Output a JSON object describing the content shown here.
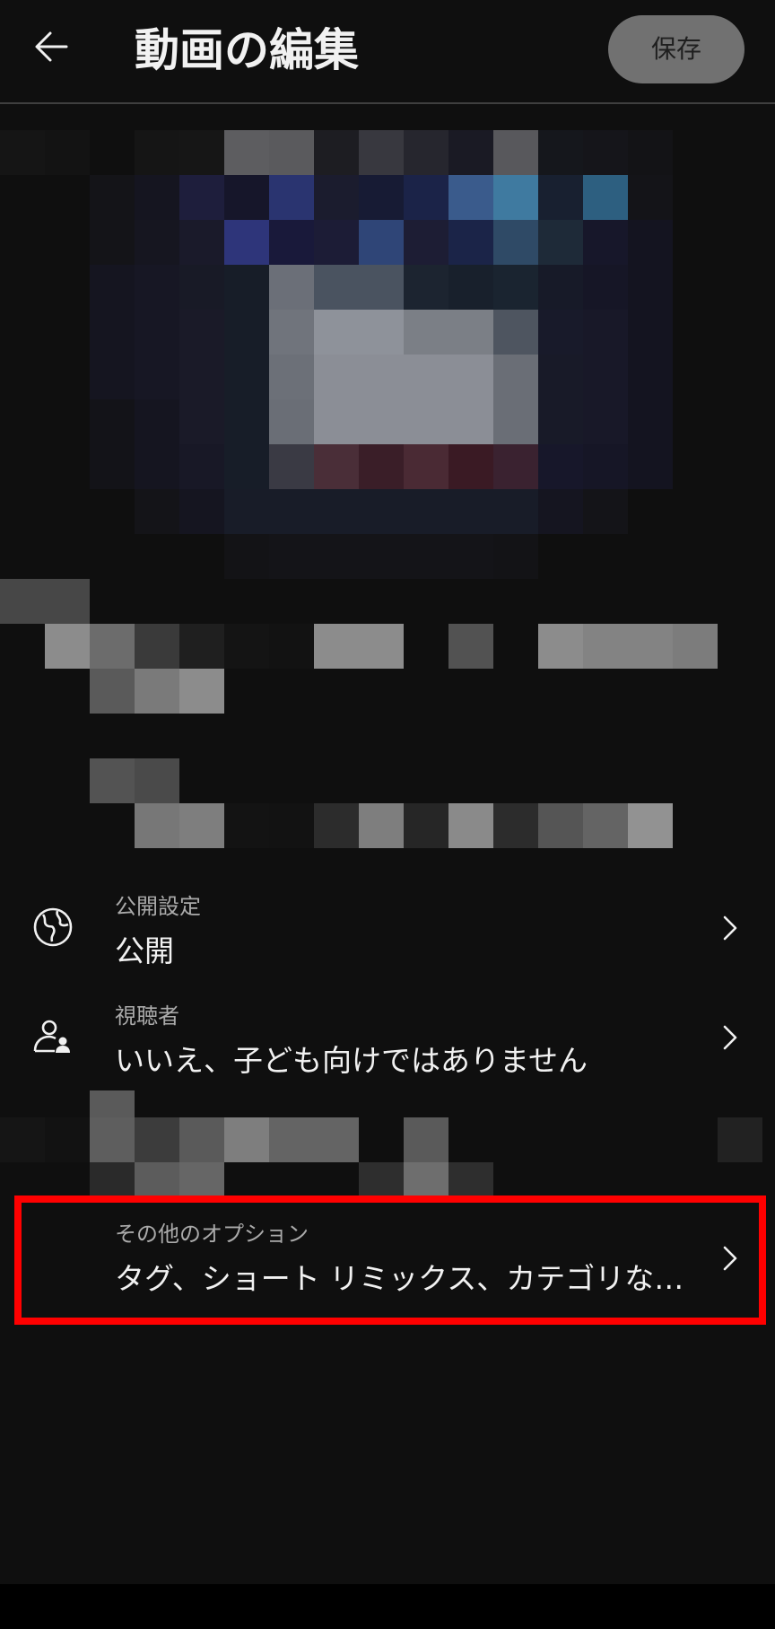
{
  "header": {
    "back_icon": "arrow-left-icon",
    "title": "動画の編集",
    "save_label": "保存"
  },
  "settings": {
    "visibility": {
      "icon": "globe-icon",
      "label": "公開設定",
      "value": "公開"
    },
    "audience": {
      "icon": "audience-icon",
      "label": "視聴者",
      "value": "いいえ、子ども向けではありません"
    },
    "more_options": {
      "label": "その他のオプション",
      "value": "タグ、ショート リミックス、カテゴリな…"
    }
  },
  "colors": {
    "background": "#0f0f0f",
    "highlight": "#ff0000",
    "save_button_bg": "#717171"
  }
}
